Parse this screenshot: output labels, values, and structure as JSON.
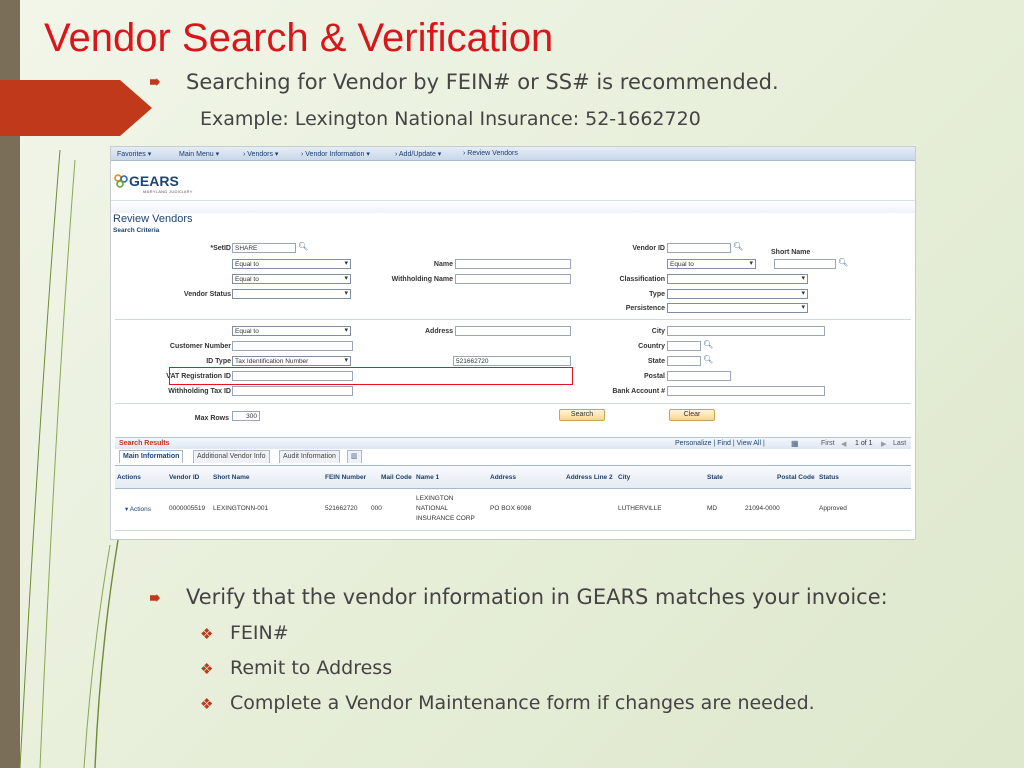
{
  "slide": {
    "title": "Vendor Search & Verification",
    "bullet1": "Searching for Vendor by FEIN# or SS# is recommended.",
    "example": "Example: Lexington National Insurance: 52-1662720",
    "bullet2": "Verify that the vendor information in GEARS matches your invoice:",
    "sub_items": [
      "FEIN#",
      "Remit to Address",
      "Complete a Vendor Maintenance form if changes are needed."
    ],
    "accent_color": "#c0391b",
    "title_color": "#d8161b"
  },
  "app": {
    "menu": [
      "Favorites ▾",
      "Main Menu ▾",
      "› Vendors ▾",
      "› Vendor Information ▾",
      "› Add/Update ▾",
      "› Review Vendors"
    ],
    "logo": "GEARS",
    "logo_sub": "MARYLAND JUDICIARY",
    "page_title": "Review Vendors",
    "section": "Search Criteria"
  },
  "form": {
    "setid_label": "*SetID",
    "setid_value": "SHARE",
    "equal_to": "Equal to",
    "name_label": "Name",
    "withholding_name_label": "Withholding Name",
    "vendor_status_label": "Vendor Status",
    "vendor_id_label": "Vendor ID",
    "short_name_label": "Short Name",
    "classification_label": "Classification",
    "type_label": "Type",
    "persistence_label": "Persistence",
    "address_label": "Address",
    "customer_number_label": "Customer Number",
    "id_type_label": "ID Type",
    "id_type_value": "Tax Identification Number",
    "id_value": "521662720",
    "vat_label": "VAT Registration ID",
    "withholding_tax_label": "Withholding Tax ID",
    "city_label": "City",
    "country_label": "Country",
    "state_label": "State",
    "postal_label": "Postal",
    "bank_label": "Bank Account #",
    "max_rows_label": "Max Rows",
    "max_rows_value": "300",
    "search_button": "Search",
    "clear_button": "Clear"
  },
  "results": {
    "title": "Search Results",
    "nav": "Personalize | Find | View All |",
    "paging_first": "First",
    "paging_count": "1 of 1",
    "paging_last": "Last",
    "tabs": [
      "Main Information",
      "Additional Vendor Info",
      "Audit Information"
    ],
    "columns": [
      "Actions",
      "Vendor ID",
      "Short Name",
      "FEIN Number",
      "Mail Code",
      "Name 1",
      "Address",
      "Address Line 2",
      "City",
      "State",
      "Postal Code",
      "Status"
    ],
    "row": {
      "actions": "▾ Actions",
      "vendor_id": "0000005519",
      "short_name": "LEXINGTONN-001",
      "fein": "521662720",
      "mail_code": "000",
      "name1_line1": "LEXINGTON",
      "name1_line2": "NATIONAL",
      "name1_line3": "INSURANCE CORP",
      "address": "PO BOX 6098",
      "city": "LUTHERVILLE",
      "state": "MD",
      "postal": "21094-0000",
      "status": "Approved"
    }
  }
}
